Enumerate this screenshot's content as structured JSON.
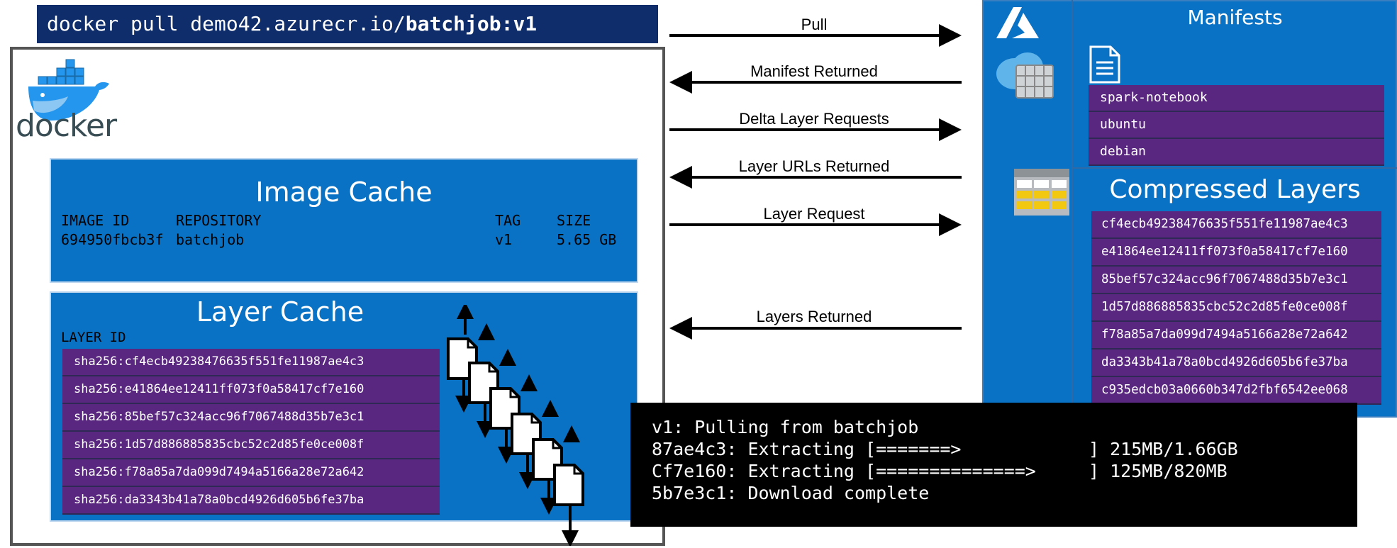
{
  "command": {
    "prefix": "docker pull demo42.azurecr.io/",
    "bold": "batchjob:v1"
  },
  "docker_logo_text": "docker",
  "image_cache": {
    "title": "Image Cache",
    "headers": [
      "IMAGE ID",
      "REPOSITORY",
      "TAG",
      "SIZE"
    ],
    "row": [
      "694950fbcb3f",
      "batchjob",
      "v1",
      "5.65 GB"
    ]
  },
  "layer_cache": {
    "title": "Layer Cache",
    "column_header": "LAYER ID",
    "layers": [
      "sha256:cf4ecb49238476635f551fe11987ae4c3",
      "sha256:e41864ee12411ff073f0a58417cf7e160",
      "sha256:85bef57c324acc96f7067488d35b7e3c1",
      "sha256:1d57d886885835cbc52c2d85fe0ce008f",
      "sha256:f78a85a7da099d7494a5166a28e72a642",
      "sha256:da3343b41a78a0bcd4926d605b6fe37ba"
    ]
  },
  "arrows": [
    {
      "label": "Pull",
      "direction": "right"
    },
    {
      "label": "Manifest Returned",
      "direction": "left"
    },
    {
      "label": "Delta Layer Requests",
      "direction": "right"
    },
    {
      "label": "Layer URLs Returned",
      "direction": "left"
    },
    {
      "label": "Layer Request",
      "direction": "right"
    },
    {
      "label": "Layers Returned",
      "direction": "left"
    }
  ],
  "registry": {
    "manifests_title": "Manifests",
    "manifests": [
      "spark-notebook",
      "ubuntu",
      "debian"
    ],
    "layers_title": "Compressed Layers",
    "compressed_layers": [
      "cf4ecb49238476635f551fe11987ae4c3",
      "e41864ee12411ff073f0a58417cf7e160",
      "85bef57c324acc96f7067488d35b7e3c1",
      "1d57d886885835cbc52c2d85fe0ce008f",
      "f78a85a7da099d7494a5166a28e72a642",
      "da3343b41a78a0bcd4926d605b6fe37ba",
      "c935edcb03a0660b347d2fbf6542ee068"
    ]
  },
  "terminal": {
    "lines": [
      {
        "left": "v1: Pulling from batchjob",
        "right": ""
      },
      {
        "left": "87ae4c3: Extracting [=======>",
        "right": "] 215MB/1.66GB"
      },
      {
        "left": "Cf7e160: Extracting [==============>",
        "right": "] 125MB/820MB"
      },
      {
        "left": "5b7e3c1: Download complete",
        "right": ""
      }
    ]
  },
  "colors": {
    "banner": "#0f2d6b",
    "blue_panel": "#0a72c4",
    "purple_row": "#5a2780",
    "docker_blue": "#2496ed",
    "terminal_bg": "#000000"
  }
}
